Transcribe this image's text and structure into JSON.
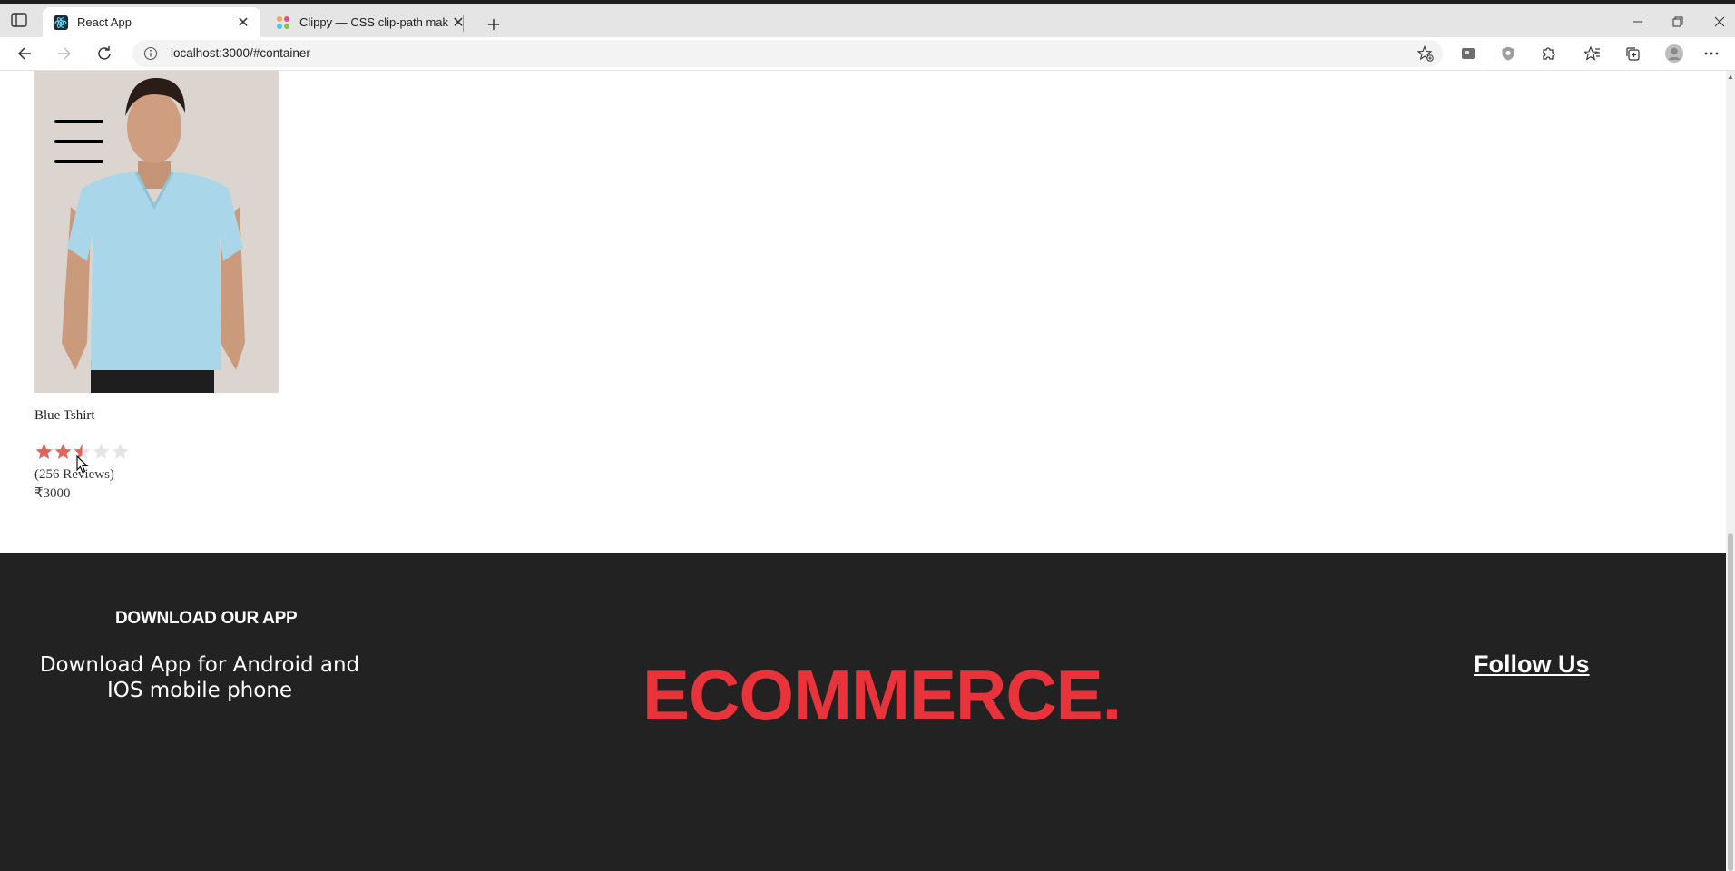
{
  "browser": {
    "tabs": [
      {
        "title": "React App",
        "favicon": "react-icon",
        "active": true
      },
      {
        "title": "Clippy — CSS clip-path maker",
        "favicon": "clippy-icon",
        "active": false
      }
    ],
    "address": {
      "url": "localhost:3000/#container"
    }
  },
  "product": {
    "name": "Blue Tshirt",
    "image": "blue-tshirt-model-photo",
    "rating": 2.5,
    "max_rating": 5,
    "reviews": "(256 Reviews)",
    "price": "₹3000"
  },
  "footer": {
    "download_heading": "DOWNLOAD OUR APP",
    "download_text": "Download App for Android and IOS mobile phone",
    "brand": "ECOMMERCE.",
    "follow": "Follow Us"
  },
  "colors": {
    "star_filled": "#e0645c",
    "star_empty": "#e4e4e4",
    "footer_bg": "#222222",
    "brand": "#e8333b"
  }
}
